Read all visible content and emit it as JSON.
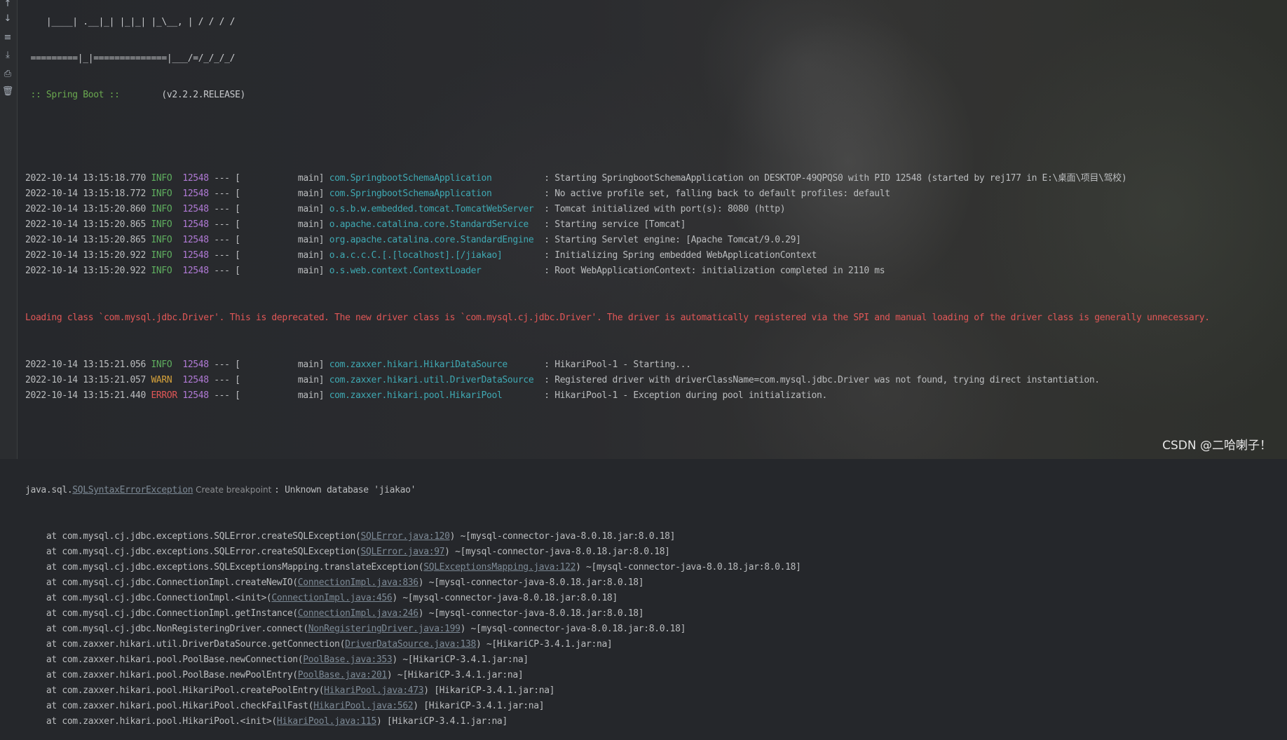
{
  "toolbar": {
    "icons": [
      "arrow-up-icon",
      "arrow-down-icon",
      "soft-wrap-icon",
      "scroll-to-end-icon",
      "print-icon",
      "clear-all-icon"
    ],
    "glyphs": [
      "↑",
      "↓",
      "≡",
      "⤓",
      "⎙",
      "🗑"
    ]
  },
  "banner": {
    "line1": "    |____| .__|_| |_|_| |_\\__, | / / / /",
    "line2": " =========|_|==============|___/=/_/_/_/",
    "spring_tag": " :: Spring Boot :: ",
    "version": "       (v2.2.2.RELEASE)"
  },
  "log": [
    {
      "ts": "2022-10-14 13:15:18.770",
      "level": "INFO",
      "pid": "12548",
      "sep": " --- [           main] ",
      "logger": "com.SpringbootSchemaApplication         ",
      "msg": " : Starting SpringbootSchemaApplication on DESKTOP-49QPQS0 with PID 12548 (started by rej177 in E:\\桌面\\项目\\驾校)"
    },
    {
      "ts": "2022-10-14 13:15:18.772",
      "level": "INFO",
      "pid": "12548",
      "sep": " --- [           main] ",
      "logger": "com.SpringbootSchemaApplication         ",
      "msg": " : No active profile set, falling back to default profiles: default"
    },
    {
      "ts": "2022-10-14 13:15:20.860",
      "level": "INFO",
      "pid": "12548",
      "sep": " --- [           main] ",
      "logger": "o.s.b.w.embedded.tomcat.TomcatWebServer ",
      "msg": " : Tomcat initialized with port(s): 8080 (http)"
    },
    {
      "ts": "2022-10-14 13:15:20.865",
      "level": "INFO",
      "pid": "12548",
      "sep": " --- [           main] ",
      "logger": "o.apache.catalina.core.StandardService  ",
      "msg": " : Starting service [Tomcat]"
    },
    {
      "ts": "2022-10-14 13:15:20.865",
      "level": "INFO",
      "pid": "12548",
      "sep": " --- [           main] ",
      "logger": "org.apache.catalina.core.StandardEngine ",
      "msg": " : Starting Servlet engine: [Apache Tomcat/9.0.29]"
    },
    {
      "ts": "2022-10-14 13:15:20.922",
      "level": "INFO",
      "pid": "12548",
      "sep": " --- [           main] ",
      "logger": "o.a.c.c.C.[.[localhost].[/jiakao]       ",
      "msg": " : Initializing Spring embedded WebApplicationContext"
    },
    {
      "ts": "2022-10-14 13:15:20.922",
      "level": "INFO",
      "pid": "12548",
      "sep": " --- [           main] ",
      "logger": "o.s.web.context.ContextLoader           ",
      "msg": " : Root WebApplicationContext: initialization completed in 2110 ms"
    }
  ],
  "driver_warning": "Loading class `com.mysql.jdbc.Driver'. This is deprecated. The new driver class is `com.mysql.cj.jdbc.Driver'. The driver is automatically registered via the SPI and manual loading of the driver class is generally unnecessary.",
  "log2": [
    {
      "ts": "2022-10-14 13:15:21.056",
      "level": "INFO",
      "pid": "12548",
      "sep": " --- [           main] ",
      "logger": "com.zaxxer.hikari.HikariDataSource      ",
      "msg": " : HikariPool-1 - Starting..."
    },
    {
      "ts": "2022-10-14 13:15:21.057",
      "level": "WARN",
      "pid": "12548",
      "sep": " --- [           main] ",
      "logger": "com.zaxxer.hikari.util.DriverDataSource ",
      "msg": " : Registered driver with driverClassName=com.mysql.jdbc.Driver was not found, trying direct instantiation."
    },
    {
      "ts": "2022-10-14 13:15:21.440",
      "level": "ERROR",
      "pid": "12548",
      "sep": " --- [           main] ",
      "logger": "com.zaxxer.hikari.pool.HikariPool       ",
      "msg": " : HikariPool-1 - Exception during pool initialization."
    }
  ],
  "exception": {
    "prefix": "java.sql.",
    "class_link": "SQLSyntaxErrorException",
    "hint": " Create breakpoint ",
    "message": ": Unknown database 'jiakao'"
  },
  "stack": [
    {
      "pre": "    at com.mysql.cj.jdbc.exceptions.SQLError.createSQLException(",
      "link": "SQLError.java:120",
      "post": ") ~[mysql-connector-java-8.0.18.jar:8.0.18]"
    },
    {
      "pre": "    at com.mysql.cj.jdbc.exceptions.SQLError.createSQLException(",
      "link": "SQLError.java:97",
      "post": ") ~[mysql-connector-java-8.0.18.jar:8.0.18]"
    },
    {
      "pre": "    at com.mysql.cj.jdbc.exceptions.SQLExceptionsMapping.translateException(",
      "link": "SQLExceptionsMapping.java:122",
      "post": ") ~[mysql-connector-java-8.0.18.jar:8.0.18]"
    },
    {
      "pre": "    at com.mysql.cj.jdbc.ConnectionImpl.createNewIO(",
      "link": "ConnectionImpl.java:836",
      "post": ") ~[mysql-connector-java-8.0.18.jar:8.0.18]"
    },
    {
      "pre": "    at com.mysql.cj.jdbc.ConnectionImpl.<init>(",
      "link": "ConnectionImpl.java:456",
      "post": ") ~[mysql-connector-java-8.0.18.jar:8.0.18]"
    },
    {
      "pre": "    at com.mysql.cj.jdbc.ConnectionImpl.getInstance(",
      "link": "ConnectionImpl.java:246",
      "post": ") ~[mysql-connector-java-8.0.18.jar:8.0.18]"
    },
    {
      "pre": "    at com.mysql.cj.jdbc.NonRegisteringDriver.connect(",
      "link": "NonRegisteringDriver.java:199",
      "post": ") ~[mysql-connector-java-8.0.18.jar:8.0.18]"
    },
    {
      "pre": "    at com.zaxxer.hikari.util.DriverDataSource.getConnection(",
      "link": "DriverDataSource.java:138",
      "post": ") ~[HikariCP-3.4.1.jar:na]"
    },
    {
      "pre": "    at com.zaxxer.hikari.pool.PoolBase.newConnection(",
      "link": "PoolBase.java:353",
      "post": ") ~[HikariCP-3.4.1.jar:na]"
    },
    {
      "pre": "    at com.zaxxer.hikari.pool.PoolBase.newPoolEntry(",
      "link": "PoolBase.java:201",
      "post": ") ~[HikariCP-3.4.1.jar:na]"
    },
    {
      "pre": "    at com.zaxxer.hikari.pool.HikariPool.createPoolEntry(",
      "link": "HikariPool.java:473",
      "post": ") [HikariCP-3.4.1.jar:na]"
    },
    {
      "pre": "    at com.zaxxer.hikari.pool.HikariPool.checkFailFast(",
      "link": "HikariPool.java:562",
      "post": ") [HikariCP-3.4.1.jar:na]"
    },
    {
      "pre": "    at com.zaxxer.hikari.pool.HikariPool.<init>(",
      "link": "HikariPool.java:115",
      "post": ") [HikariCP-3.4.1.jar:na]"
    }
  ],
  "watermark": "CSDN @二哈喇子！"
}
